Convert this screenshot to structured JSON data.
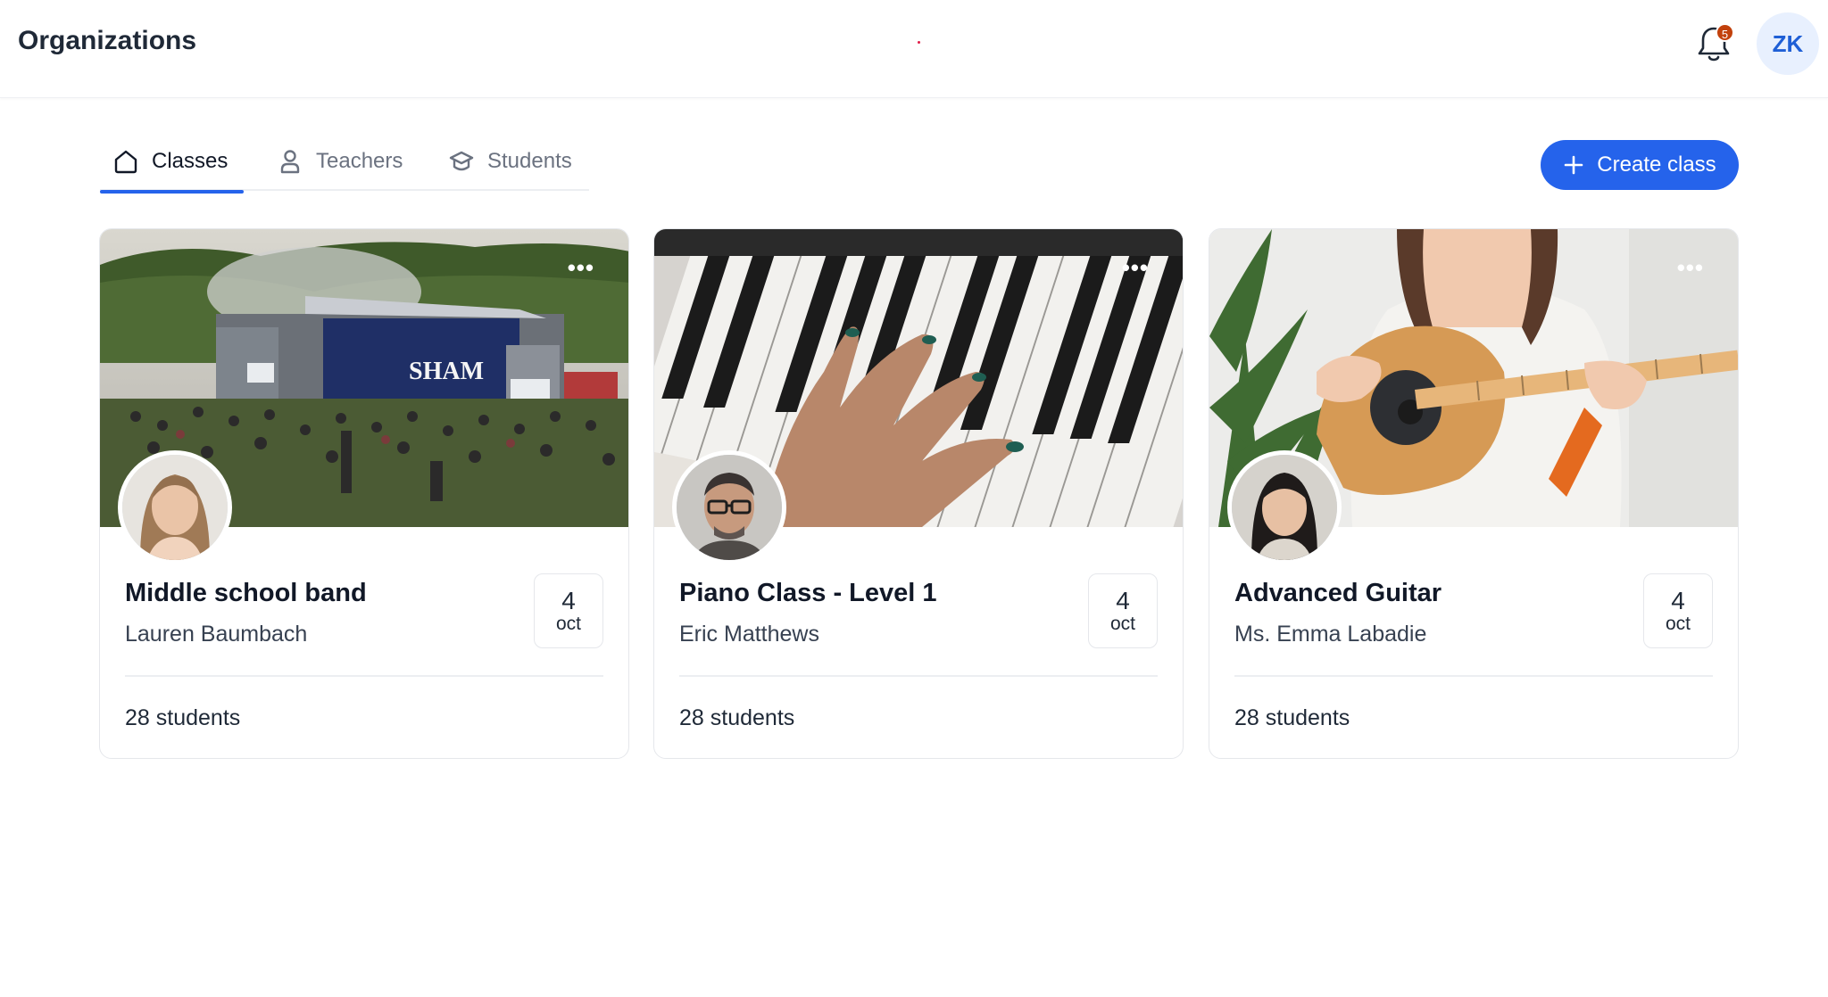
{
  "header": {
    "title": "Organizations",
    "notification_count": "5",
    "user_initials": "ZK"
  },
  "tabs": [
    {
      "label": "Classes",
      "icon": "home-icon",
      "active": true
    },
    {
      "label": "Teachers",
      "icon": "user-icon",
      "active": false
    },
    {
      "label": "Students",
      "icon": "graduation-cap-icon",
      "active": false
    }
  ],
  "create_button": {
    "label": "Create class",
    "icon": "plus-icon"
  },
  "classes": [
    {
      "title": "Middle school band",
      "teacher": "Lauren Baumbach",
      "day": "4",
      "month": "oct",
      "students": "28 students",
      "image": "concert-stage-photo",
      "banner_text": "SHAM"
    },
    {
      "title": "Piano Class - Level 1",
      "teacher": "Eric Matthews",
      "day": "4",
      "month": "oct",
      "students": "28 students",
      "image": "piano-keys-photo"
    },
    {
      "title": "Advanced Guitar",
      "teacher": "Ms. Emma Labadie",
      "day": "4",
      "month": "oct",
      "students": "28 students",
      "image": "guitar-player-photo"
    }
  ],
  "colors": {
    "accent": "#2563eb",
    "badge": "#c2410c",
    "avatar_bg": "#e8f0fe"
  }
}
